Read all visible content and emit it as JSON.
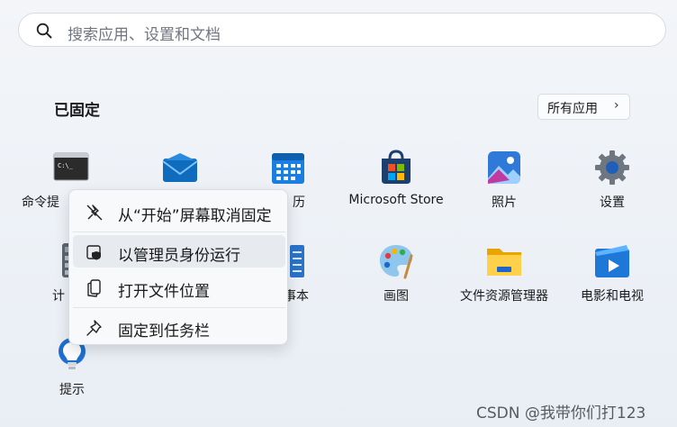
{
  "search": {
    "placeholder": "搜索应用、设置和文档"
  },
  "pinned": {
    "title": "已固定",
    "all_apps_label": "所有应用",
    "all_apps_chevron": "›"
  },
  "apps": [
    {
      "name": "命令提示符",
      "visible_label": "命令提",
      "icon": "command-prompt-icon"
    },
    {
      "name": "邮件",
      "visible_label": "",
      "icon": "mail-icon"
    },
    {
      "name": "日历",
      "visible_label": "历",
      "icon": "calendar-icon"
    },
    {
      "name": "Microsoft Store",
      "visible_label": "Microsoft Store",
      "icon": "microsoft-store-icon"
    },
    {
      "name": "照片",
      "visible_label": "照片",
      "icon": "photos-icon"
    },
    {
      "name": "设置",
      "visible_label": "设置",
      "icon": "settings-gear-icon"
    },
    {
      "name": "计算器",
      "visible_label": "计",
      "icon": "calculator-icon"
    },
    {
      "name": "记事本",
      "visible_label": "事本",
      "icon": "notepad-icon"
    },
    {
      "name": "画图",
      "visible_label": "画图",
      "icon": "paint-palette-icon"
    },
    {
      "name": "文件资源管理器",
      "visible_label": "文件资源管理器",
      "icon": "file-explorer-icon"
    },
    {
      "name": "电影和电视",
      "visible_label": "电影和电视",
      "icon": "movies-tv-icon"
    },
    {
      "name": "提示",
      "visible_label": "提示",
      "icon": "tips-bulb-icon"
    }
  ],
  "context_menu": {
    "items": [
      {
        "label": "从“开始”屏幕取消固定",
        "icon": "unpin-icon"
      },
      {
        "label": "以管理员身份运行",
        "icon": "shield-admin-icon",
        "highlighted": true
      },
      {
        "label": "打开文件位置",
        "icon": "open-file-location-icon"
      },
      {
        "label": "固定到任务栏",
        "icon": "pin-icon"
      }
    ]
  },
  "watermark": "CSDN @我带你们打123",
  "colors": {
    "accent": "#0067c0",
    "menu_bg": "#f7f9fb",
    "highlight": "#e7eaee"
  }
}
